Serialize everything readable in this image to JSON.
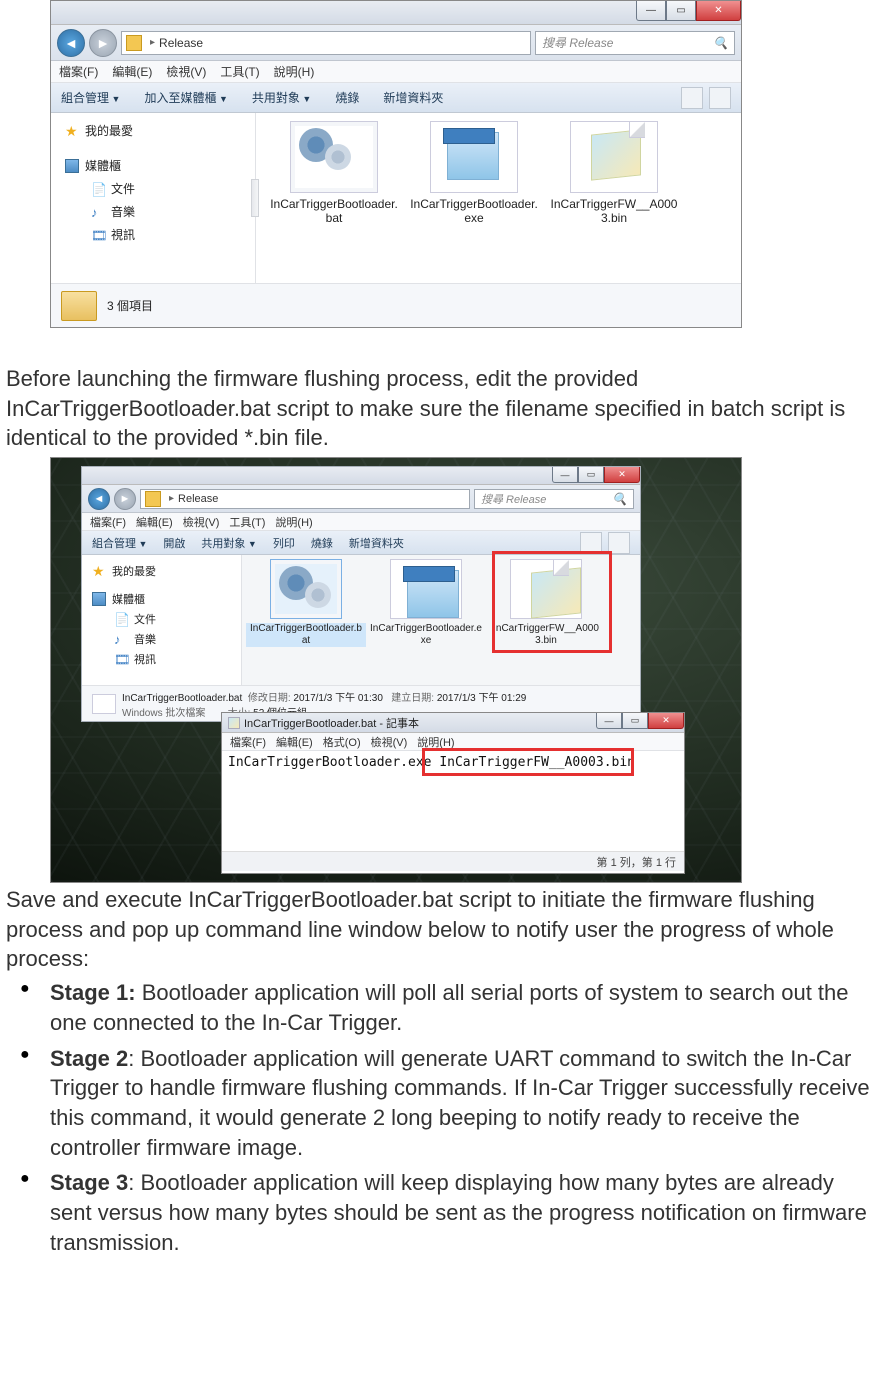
{
  "win1": {
    "breadcrumb": {
      "segment": "Release"
    },
    "search_placeholder": "搜尋 Release",
    "menu": {
      "file": "檔案(F)",
      "edit": "編輯(E)",
      "view": "檢視(V)",
      "tools": "工具(T)",
      "help": "說明(H)"
    },
    "toolbar": {
      "organize": "組合管理",
      "include": "加入至媒體櫃",
      "share": "共用對象",
      "burn": "燒錄",
      "newfolder": "新增資料夾"
    },
    "sidebar": {
      "favorites": "我的最愛",
      "libraries": "媒體櫃",
      "documents": "文件",
      "music": "音樂",
      "videos": "視訊"
    },
    "files": {
      "f1": "InCarTriggerBootloader.bat",
      "f2": "InCarTriggerBootloader.exe",
      "f3": "InCarTriggerFW__A0003.bin"
    },
    "status": "3 個項目"
  },
  "para1": "Before launching the firmware flushing process, edit the provided InCarTriggerBootloader.bat script to make sure the filename specified in batch script is identical to the provided *.bin file.",
  "win2": {
    "breadcrumb": {
      "segment": "Release"
    },
    "search_placeholder": "搜尋 Release",
    "menu": {
      "file": "檔案(F)",
      "edit": "編輯(E)",
      "view": "檢視(V)",
      "tools": "工具(T)",
      "help": "說明(H)"
    },
    "toolbar": {
      "organize": "組合管理",
      "open": "開啟",
      "share": "共用對象",
      "print": "列印",
      "burn": "燒錄",
      "newfolder": "新增資料夾"
    },
    "sidebar": {
      "favorites": "我的最愛",
      "libraries": "媒體櫃",
      "documents": "文件",
      "music": "音樂",
      "videos": "視訊"
    },
    "files": {
      "f1": "InCarTriggerBootloader.bat",
      "f2": "InCarTriggerBootloader.exe",
      "f3": "InCarTriggerFW__A0003.bin"
    },
    "status_name": "InCarTriggerBootloader.bat",
    "status_type": "Windows 批次檔案",
    "status_mod_label": "修改日期:",
    "status_mod": "2017/1/3 下午 01:30",
    "status_create_label": "建立日期:",
    "status_create": "2017/1/3 下午 01:29",
    "status_size_label": "大小:",
    "status_size": "52 個位元組"
  },
  "notepad": {
    "title": "InCarTriggerBootloader.bat - 記事本",
    "menu": {
      "file": "檔案(F)",
      "edit": "編輯(E)",
      "format": "格式(O)",
      "view": "檢視(V)",
      "help": "說明(H)"
    },
    "content_left": "InCarTriggerBootloader.exe ",
    "content_right": "InCarTriggerFW__A0003.bin",
    "status": "第 1 列，第 1 行"
  },
  "para2": "Save and execute InCarTriggerBootloader.bat script to initiate the firmware flushing process and pop up command line window below to notify user the progress of whole process:",
  "stages": {
    "s1_label": "Stage 1:",
    "s1_text": " Bootloader application will poll all serial ports of system to search out the one connected to the In-Car Trigger.",
    "s2_label": "Stage 2",
    "s2_text": ": Bootloader application will generate UART command to switch the In-Car Trigger to handle firmware flushing commands. If In-Car Trigger successfully receive this command, it would generate 2 long beeping to notify ready to receive the controller firmware image.",
    "s3_label": "Stage 3",
    "s3_text": ": Bootloader application will keep displaying how many bytes are already sent versus how many bytes should be sent as the progress notification on firmware transmission."
  }
}
